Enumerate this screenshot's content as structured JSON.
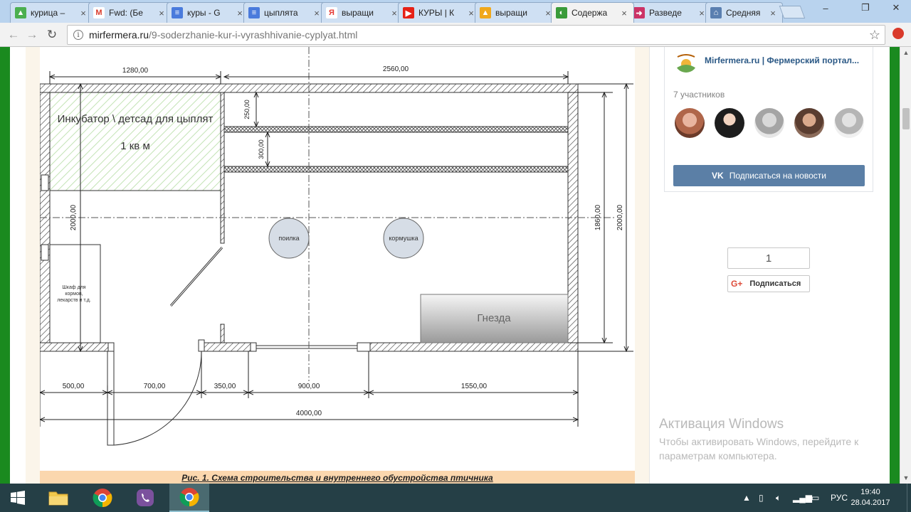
{
  "browser": {
    "tabs": [
      {
        "title": "курица –",
        "favicon": "google-drive-icon",
        "color": "#4caf50",
        "active": false
      },
      {
        "title": "Fwd: (Бе",
        "favicon": "gmail-icon",
        "color": "#d93a2b",
        "active": false
      },
      {
        "title": "куры - G",
        "favicon": "google-docs-icon",
        "color": "#4a7bdc",
        "active": false
      },
      {
        "title": "цыплята",
        "favicon": "google-docs-icon",
        "color": "#4a7bdc",
        "active": false
      },
      {
        "title": "выращи",
        "favicon": "yandex-icon",
        "color": "#e53935",
        "active": false
      },
      {
        "title": "КУРЫ | К",
        "favicon": "youtube-icon",
        "color": "#e62117",
        "active": false
      },
      {
        "title": "выращи",
        "favicon": "image-icon",
        "color": "#f0a81c",
        "active": false
      },
      {
        "title": "Содержа",
        "favicon": "mirfermera-icon",
        "color": "#3a9b3a",
        "active": true
      },
      {
        "title": "Разведе",
        "favicon": "bookmark-icon",
        "color": "#cc3366",
        "active": false
      },
      {
        "title": "Средняя",
        "favicon": "house-icon",
        "color": "#5a7fb0",
        "active": false
      }
    ],
    "close_glyph": "×",
    "window_controls": {
      "minimize": "–",
      "maximize": "❐",
      "close": "✕"
    },
    "nav": {
      "back": "←",
      "forward": "→",
      "reload": "↻"
    },
    "url_host": "mirfermera.ru",
    "url_path": "/9-soderzhanie-kur-i-vyrashhivanie-cyplyat.html",
    "info_glyph": "i",
    "bookmark_glyph": "☆"
  },
  "drawing": {
    "labels": {
      "incubator_line1": "Инкубатор \\ детсад для цыплят",
      "incubator_line2": "1 кв м",
      "waterer": "поилка",
      "feeder": "кормушка",
      "nests": "Гнезда",
      "cabinet_line1": "Шкаф для",
      "cabinet_line2": "кормов,",
      "cabinet_line3": "лекарств и т.д."
    },
    "dimensions": {
      "top_left": "1280,00",
      "top_right": "2560,00",
      "shelf_gap1": "250,00",
      "shelf_gap2": "300,00",
      "left_height": "2000,00",
      "right_inner": "1860,00",
      "right_outer": "2000,00",
      "bottom_500": "500,00",
      "bottom_700": "700,00",
      "bottom_350": "350,00",
      "bottom_900": "900,00",
      "bottom_1550": "1550,00",
      "bottom_total": "4000,00"
    },
    "caption": "Рис. 1. Схема строительства и внутреннего обустройства птичника"
  },
  "sidebar": {
    "vk": {
      "group_name": "Mirfermera.ru | Фермерский портал...",
      "members": "7 участников",
      "subscribe_mark": "VK",
      "subscribe": "Подписаться на новости"
    },
    "gplus": {
      "count": "1",
      "logo": "G+",
      "subscribe": "Подписаться"
    }
  },
  "watermark": {
    "title": "Активация Windows",
    "text": "Чтобы активировать Windows, перейдите к параметрам компьютера."
  },
  "taskbar": {
    "language": "РУС",
    "time": "19:40",
    "date": "28.04.2017"
  },
  "colors": {
    "page_green": "#1a8a1f",
    "vk_blue": "#5b7fa6",
    "taskbar": "#253f46",
    "caption_bg": "#fbd7ae"
  }
}
